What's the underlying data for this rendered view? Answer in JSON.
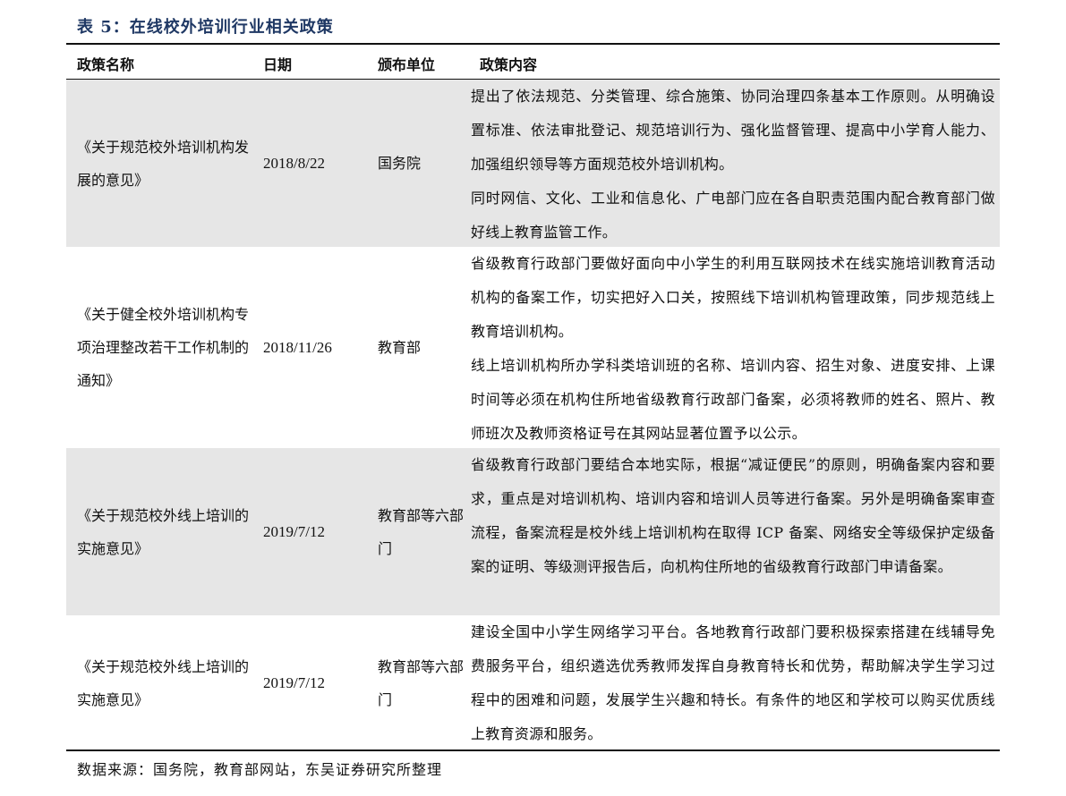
{
  "caption": "表 5：在线校外培训行业相关政策",
  "headers": {
    "name": "政策名称",
    "date": "日期",
    "unit": "颁布单位",
    "content": "政策内容"
  },
  "rows": [
    {
      "name": "《关于规范校外培训机构发展的意见》",
      "date": "2018/8/22",
      "unit": "国务院",
      "paragraphs": [
        "提出了依法规范、分类管理、综合施策、协同治理四条基本工作原则。从明确设置标准、依法审批登记、规范培训行为、强化监督管理、提高中小学育人能力、加强组织领导等方面规范校外培训机构。",
        "同时网信、文化、工业和信息化、广电部门应在各自职责范围内配合教育部门做好线上教育监管工作。"
      ]
    },
    {
      "name": "《关于健全校外培训机构专项治理整改若干工作机制的通知》",
      "date": "2018/11/26",
      "unit": "教育部",
      "paragraphs": [
        "省级教育行政部门要做好面向中小学生的利用互联网技术在线实施培训教育活动机构的备案工作，切实把好入口关，按照线下培训机构管理政策，同步规范线上教育培训机构。",
        "线上培训机构所办学科类培训班的名称、培训内容、招生对象、进度安排、上课时间等必须在机构住所地省级教育行政部门备案，必须将教师的姓名、照片、教师班次及教师资格证号在其网站显著位置予以公示。"
      ]
    },
    {
      "name": "《关于规范校外线上培训的实施意见》",
      "date": "2019/7/12",
      "unit": "教育部等六部门",
      "paragraphs": [
        "省级教育行政部门要结合本地实际，根据“减证便民”的原则，明确备案内容和要求，重点是对培训机构、培训内容和培训人员等进行备案。另外是明确备案审查流程，备案流程是校外线上培训机构在取得 ICP 备案、网络安全等级保护定级备案的证明、等级测评报告后，向机构住所地的省级教育行政部门申请备案。"
      ]
    },
    {
      "name": "《关于规范校外线上培训的实施意见》",
      "date": "2019/7/12",
      "unit": "教育部等六部门",
      "paragraphs": [
        "建设全国中小学生网络学习平台。各地教育行政部门要积极探索搭建在线辅导免费服务平台，组织遴选优秀教师发挥自身教育特长和优势，帮助解决学生学习过程中的困难和问题，发展学生兴趣和特长。有条件的地区和学校可以购买优质线上教育资源和服务。"
      ]
    }
  ],
  "source": "数据来源：国务院，教育部网站，东吴证券研究所整理"
}
